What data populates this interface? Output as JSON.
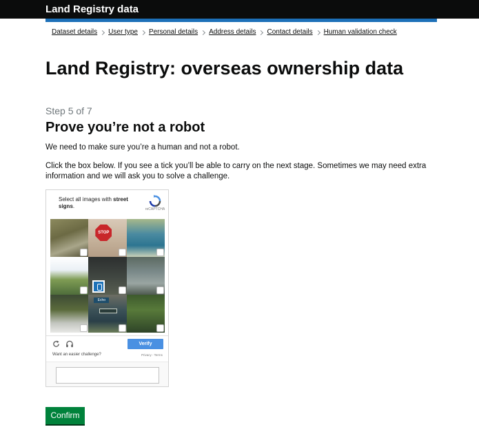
{
  "header": {
    "title": "Land Registry data"
  },
  "breadcrumbs": [
    {
      "label": "Dataset details"
    },
    {
      "label": "User type"
    },
    {
      "label": "Personal details"
    },
    {
      "label": "Address details"
    },
    {
      "label": "Contact details"
    },
    {
      "label": "Human validation check"
    }
  ],
  "main": {
    "page_title": "Land Registry: overseas ownership data",
    "step": "Step 5 of 7",
    "heading": "Prove you’re not a robot",
    "paragraph1": "We need to make sure you’re a human and not a robot.",
    "paragraph2": "Click the box below. If you see a tick you’ll be able to carry on the next stage. Sometimes we may need extra information and we will ask you to solve a challenge."
  },
  "captcha": {
    "prompt_prefix": "Select all images with ",
    "prompt_target": "street signs",
    "prompt_suffix": ".",
    "logo_text": "reCAPTCHA",
    "stop_sign_text": "STOP",
    "street_sign_text": "Echo",
    "verify_label": "Verify",
    "easier_link": "Want an easier challenge?",
    "privacy_terms": "Privacy - Terms",
    "accent_color": "#4a90e2"
  },
  "actions": {
    "confirm_label": "Confirm",
    "confirm_color": "#00823b"
  }
}
